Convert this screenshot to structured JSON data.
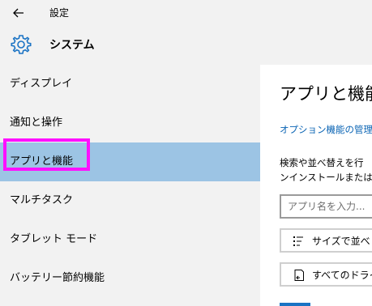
{
  "window": {
    "title": "設定"
  },
  "header": {
    "title": "システム"
  },
  "sidebar": {
    "items": [
      {
        "label": "ディスプレイ"
      },
      {
        "label": "通知と操作"
      },
      {
        "label": "アプリと機能"
      },
      {
        "label": "マルチタスク"
      },
      {
        "label": "タブレット モード"
      },
      {
        "label": "バッテリー節約機能"
      }
    ]
  },
  "main": {
    "title": "アプリと機能",
    "optional_link": "オプション機能の管理",
    "description_line1": "検索や並べ替えを行",
    "description_line2": "ンインストールまたは",
    "search_placeholder": "アプリ名を入力...",
    "sort_label": "サイズで並べ",
    "drive_label": "すべてのドライ"
  },
  "colors": {
    "selected": "#9cc4e4",
    "highlight": "#ff10ff",
    "link": "#0a64b4"
  }
}
